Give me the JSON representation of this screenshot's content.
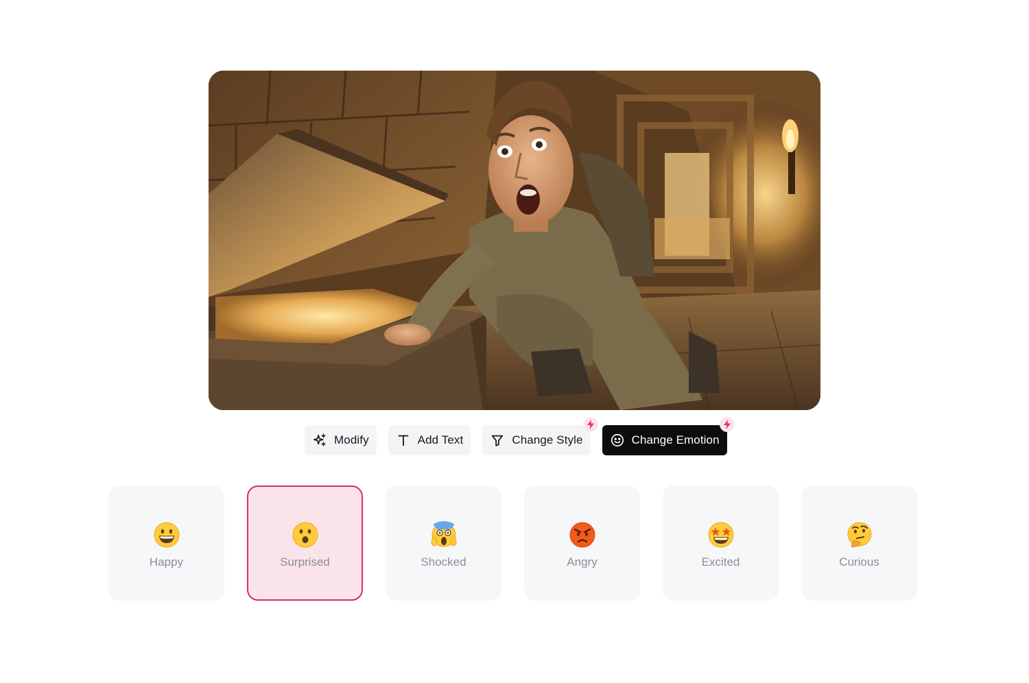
{
  "toolbar": {
    "tools": [
      {
        "label": "Modify",
        "icon": "sparkles-icon",
        "active": false,
        "pro": false
      },
      {
        "label": "Add Text",
        "icon": "text-icon",
        "active": false,
        "pro": false
      },
      {
        "label": "Change Style",
        "icon": "filter-icon",
        "active": false,
        "pro": true
      },
      {
        "label": "Change Emotion",
        "icon": "smile-icon",
        "active": true,
        "pro": true
      }
    ]
  },
  "emotions": {
    "selected": "Surprised",
    "items": [
      {
        "label": "Happy",
        "icon": "grinning-face-icon"
      },
      {
        "label": "Surprised",
        "icon": "surprised-face-icon"
      },
      {
        "label": "Shocked",
        "icon": "screaming-face-icon"
      },
      {
        "label": "Angry",
        "icon": "angry-face-icon"
      },
      {
        "label": "Excited",
        "icon": "star-struck-face-icon"
      },
      {
        "label": "Curious",
        "icon": "thinking-face-icon"
      }
    ]
  },
  "colors": {
    "accent": "#dc2d5f",
    "selected_bg": "#fbe3ea",
    "active_tool_bg": "#0d0d0f",
    "card_bg": "#f6f7f9"
  }
}
